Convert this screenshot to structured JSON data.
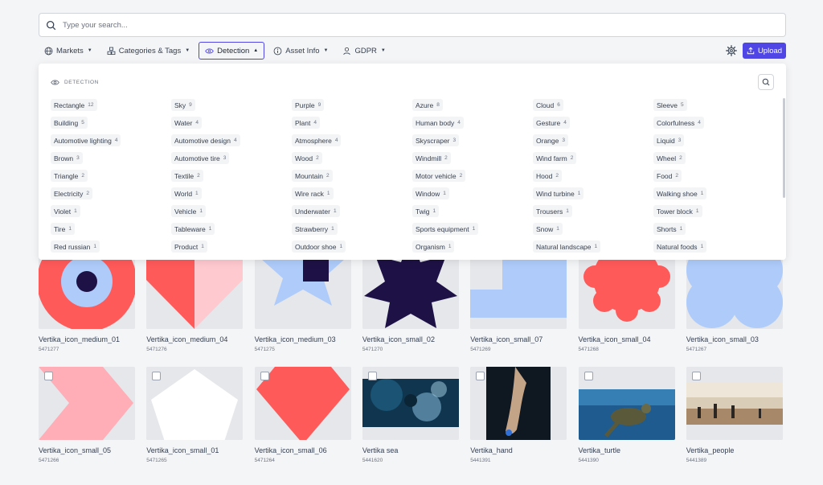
{
  "search": {
    "placeholder": "Type your search..."
  },
  "filters": [
    {
      "label": "Markets",
      "icon": "globe-icon"
    },
    {
      "label": "Categories & Tags",
      "icon": "tags-icon"
    },
    {
      "label": "Detection",
      "icon": "eye-icon",
      "active": true
    },
    {
      "label": "Asset Info",
      "icon": "info-icon"
    },
    {
      "label": "GDPR",
      "icon": "user-icon"
    }
  ],
  "toolbar": {
    "upload_label": "Upload",
    "accent": "#4f46e5"
  },
  "detection_panel": {
    "title": "DETECTION",
    "tags": [
      [
        "Rectangle",
        "12"
      ],
      [
        "Sky",
        "9"
      ],
      [
        "Purple",
        "9"
      ],
      [
        "Azure",
        "8"
      ],
      [
        "Cloud",
        "6"
      ],
      [
        "Sleeve",
        "5"
      ],
      [
        "Building",
        "5"
      ],
      [
        "Water",
        "4"
      ],
      [
        "Plant",
        "4"
      ],
      [
        "Human body",
        "4"
      ],
      [
        "Gesture",
        "4"
      ],
      [
        "Colorfulness",
        "4"
      ],
      [
        "Automotive lighting",
        "4"
      ],
      [
        "Automotive design",
        "4"
      ],
      [
        "Atmosphere",
        "4"
      ],
      [
        "Skyscraper",
        "3"
      ],
      [
        "Orange",
        "3"
      ],
      [
        "Liquid",
        "3"
      ],
      [
        "Brown",
        "3"
      ],
      [
        "Automotive tire",
        "3"
      ],
      [
        "Wood",
        "2"
      ],
      [
        "Windmill",
        "2"
      ],
      [
        "Wind farm",
        "2"
      ],
      [
        "Wheel",
        "2"
      ],
      [
        "Triangle",
        "2"
      ],
      [
        "Textile",
        "2"
      ],
      [
        "Mountain",
        "2"
      ],
      [
        "Motor vehicle",
        "2"
      ],
      [
        "Hood",
        "2"
      ],
      [
        "Food",
        "2"
      ],
      [
        "Electricity",
        "2"
      ],
      [
        "World",
        "1"
      ],
      [
        "Wire rack",
        "1"
      ],
      [
        "Window",
        "1"
      ],
      [
        "Wind turbine",
        "1"
      ],
      [
        "Walking shoe",
        "1"
      ],
      [
        "Violet",
        "1"
      ],
      [
        "Vehicle",
        "1"
      ],
      [
        "Underwater",
        "1"
      ],
      [
        "Twig",
        "1"
      ],
      [
        "Trousers",
        "1"
      ],
      [
        "Tower block",
        "1"
      ],
      [
        "Tire",
        "1"
      ],
      [
        "Tableware",
        "1"
      ],
      [
        "Strawberry",
        "1"
      ],
      [
        "Sports equipment",
        "1"
      ],
      [
        "Snow",
        "1"
      ],
      [
        "Shorts",
        "1"
      ],
      [
        "Red russian",
        "1"
      ],
      [
        "Product",
        "1"
      ],
      [
        "Outdoor shoe",
        "1"
      ],
      [
        "Organism",
        "1"
      ],
      [
        "Natural landscape",
        "1"
      ],
      [
        "Natural foods",
        "1"
      ]
    ]
  },
  "assets": [
    {
      "name": "Vertika_icon_medium_01",
      "id": "5471277",
      "art": "target"
    },
    {
      "name": "Vertika_icon_medium_04",
      "id": "5471276",
      "art": "pink-split"
    },
    {
      "name": "Vertika_icon_medium_03",
      "id": "5471275",
      "art": "blue-star"
    },
    {
      "name": "Vertika_icon_small_02",
      "id": "5471270",
      "art": "navy-star"
    },
    {
      "name": "Vertika_icon_small_07",
      "id": "5471269",
      "art": "blue-steps"
    },
    {
      "name": "Vertika_icon_small_04",
      "id": "5471268",
      "art": "red-flower"
    },
    {
      "name": "Vertika_icon_small_03",
      "id": "5471267",
      "art": "blue-circles"
    },
    {
      "name": "Vertika_icon_small_05",
      "id": "5471266",
      "art": "pink-chevron"
    },
    {
      "name": "Vertika_icon_small_01",
      "id": "5471265",
      "art": "pentagon"
    },
    {
      "name": "Vertika_icon_small_06",
      "id": "5471264",
      "art": "red-gem"
    },
    {
      "name": "Vertika sea",
      "id": "5441620",
      "art": "sea"
    },
    {
      "name": "Vertika_hand",
      "id": "5441391",
      "art": "hand"
    },
    {
      "name": "Vertika_turtle",
      "id": "5441390",
      "art": "turtle"
    },
    {
      "name": "Vertika_people",
      "id": "5441389",
      "art": "people"
    }
  ]
}
